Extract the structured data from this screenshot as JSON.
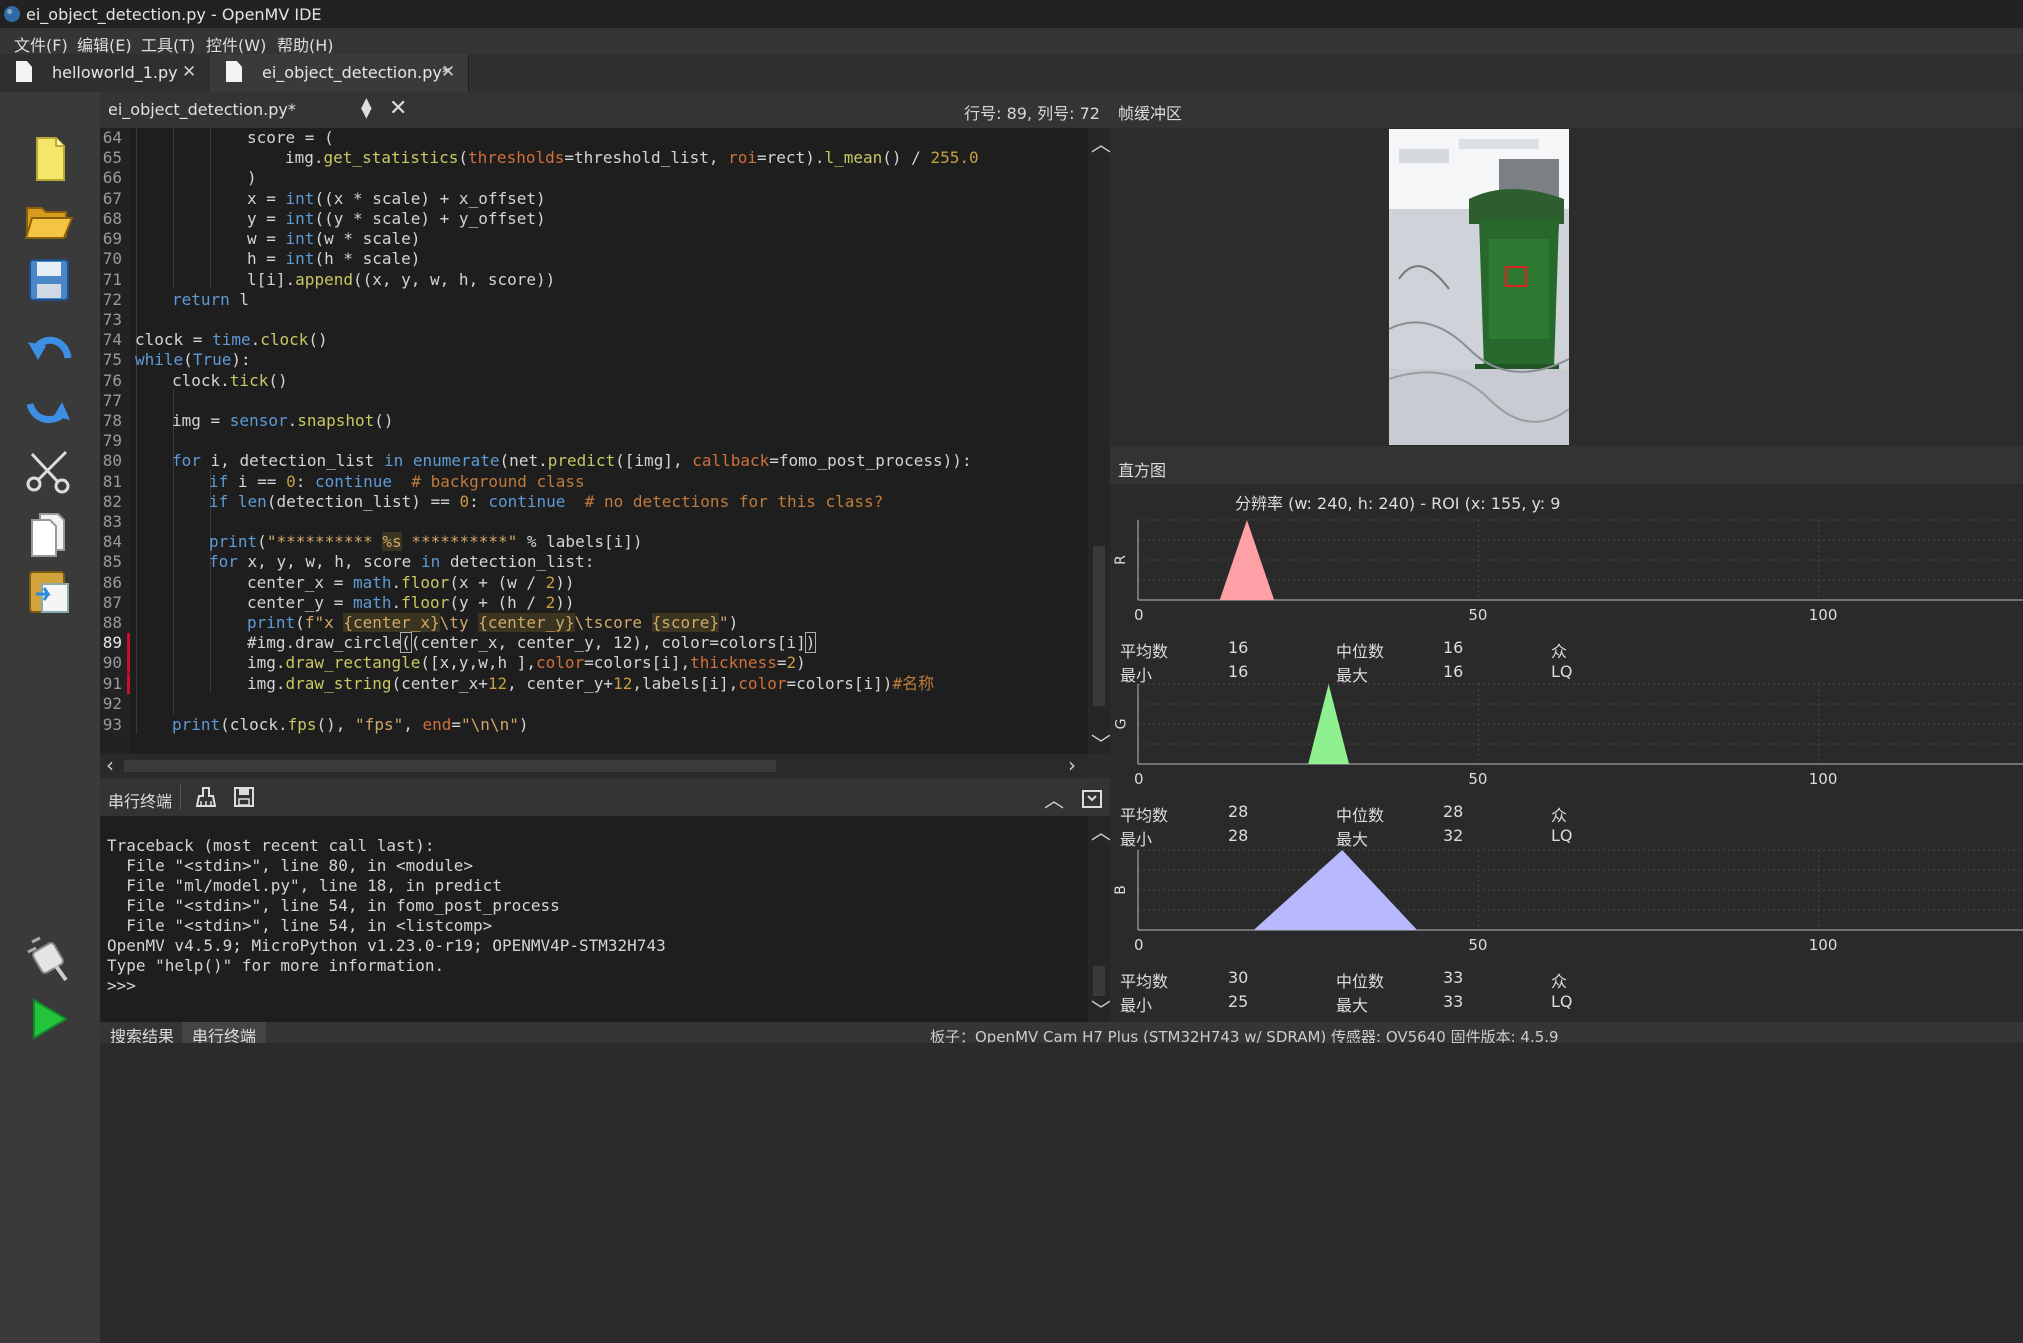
{
  "window": {
    "title": "ei_object_detection.py - OpenMV IDE"
  },
  "menu": [
    "文件(F)",
    "编辑(E)",
    "工具(T)",
    "控件(W)",
    "帮助(H)"
  ],
  "tabs": [
    {
      "label": "helloworld_1.py"
    },
    {
      "label": "ei_object_detection.py*"
    }
  ],
  "toolbar": {
    "icons": [
      "new-file-icon",
      "open-folder-icon",
      "save-icon",
      "undo-icon",
      "redo-icon",
      "cut-icon",
      "copy-icon",
      "paste-icon",
      "connect-icon",
      "run-icon"
    ]
  },
  "editor": {
    "doc_name": "ei_object_detection.py*",
    "position": "行号: 89, 列号: 72",
    "current_line": 89,
    "lines": [
      {
        "n": "64",
        "t": "score = ("
      },
      {
        "n": "65",
        "t": "img.get_statistics(thresholds=threshold_list, roi=rect).l_mean() / 255.0"
      },
      {
        "n": "66",
        "t": ")"
      },
      {
        "n": "67",
        "t": "x = int((x * scale) + x_offset)"
      },
      {
        "n": "68",
        "t": "y = int((y * scale) + y_offset)"
      },
      {
        "n": "69",
        "t": "w = int(w * scale)"
      },
      {
        "n": "70",
        "t": "h = int(h * scale)"
      },
      {
        "n": "71",
        "t": "l[i].append((x, y, w, h, score))"
      },
      {
        "n": "72",
        "t": "return l"
      },
      {
        "n": "73",
        "t": ""
      },
      {
        "n": "74",
        "t": "clock = time.clock()"
      },
      {
        "n": "75",
        "t": "while(True):"
      },
      {
        "n": "76",
        "t": "clock.tick()"
      },
      {
        "n": "77",
        "t": ""
      },
      {
        "n": "78",
        "t": "img = sensor.snapshot()"
      },
      {
        "n": "79",
        "t": ""
      },
      {
        "n": "80",
        "t": "for i, detection_list in enumerate(net.predict([img], callback=fomo_post_process)):"
      },
      {
        "n": "81",
        "t": "if i == 0: continue  # background class"
      },
      {
        "n": "82",
        "t": "if len(detection_list) == 0: continue  # no detections for this class?"
      },
      {
        "n": "83",
        "t": ""
      },
      {
        "n": "84",
        "t": "print(\"********** %s **********\" % labels[i])"
      },
      {
        "n": "85",
        "t": "for x, y, w, h, score in detection_list:"
      },
      {
        "n": "86",
        "t": "center_x = math.floor(x + (w / 2))"
      },
      {
        "n": "87",
        "t": "center_y = math.floor(y + (h / 2))"
      },
      {
        "n": "88",
        "t": "print(f\"x {center_x}\\ty {center_y}\\tscore {score}\")"
      },
      {
        "n": "89",
        "t": "#img.draw_circle((center_x, center_y, 12), color=colors[i])"
      },
      {
        "n": "90",
        "t": "img.draw_rectangle([x,y,w,h ],color=colors[i],thickness=2)"
      },
      {
        "n": "91",
        "t": "img.draw_string(center_x+12, center_y+12,labels[i],color=colors[i])#名称"
      },
      {
        "n": "92",
        "t": ""
      },
      {
        "n": "93",
        "t": "print(clock.fps(), \"fps\", end=\"\\n\\n\")"
      }
    ]
  },
  "terminal": {
    "label": "串行终端",
    "lines": [
      "Traceback (most recent call last):",
      "  File \"<stdin>\", line 80, in <module>",
      "  File \"ml/model.py\", line 18, in predict",
      "  File \"<stdin>\", line 54, in fomo_post_process",
      "  File \"<stdin>\", line 54, in <listcomp>",
      "OpenMV v4.5.9; MicroPython v1.23.0-r19; OPENMV4P-STM32H743",
      "Type \"help()\" for more information.",
      ">>>"
    ]
  },
  "framebuffer": {
    "label": "帧缓冲区"
  },
  "histogram": {
    "label": "直方图",
    "info": "分辨率  (w: 240,  h: 240)  - ROI  (x: 155,  y: 9",
    "ticks": [
      "0",
      "50",
      "100"
    ],
    "stat_labels": {
      "mean": "平均数",
      "median": "中位数",
      "min": "最小",
      "max": "最大",
      "mode": "众",
      "lq": "LQ"
    },
    "channels": [
      {
        "name": "R",
        "color": "#ff9fa6",
        "mean": "16",
        "median": "16",
        "min": "16",
        "max": "16",
        "peak_x": [
          12,
          16,
          20
        ]
      },
      {
        "name": "G",
        "color": "#8ff08f",
        "mean": "28",
        "median": "28",
        "min": "28",
        "max": "32",
        "peak_x": [
          25,
          28,
          31
        ]
      },
      {
        "name": "B",
        "color": "#b8b8ff",
        "mean": "30",
        "median": "33",
        "min": "25",
        "max": "33",
        "peak_x": [
          17,
          30,
          41
        ]
      }
    ]
  },
  "bottom": {
    "tabs": [
      "搜索结果",
      "串行终端"
    ],
    "status": "板子：OpenMV Cam H7 Plus (STM32H743 w/ SDRAM)      传感器: OV5640      固件版本: 4.5.9"
  }
}
